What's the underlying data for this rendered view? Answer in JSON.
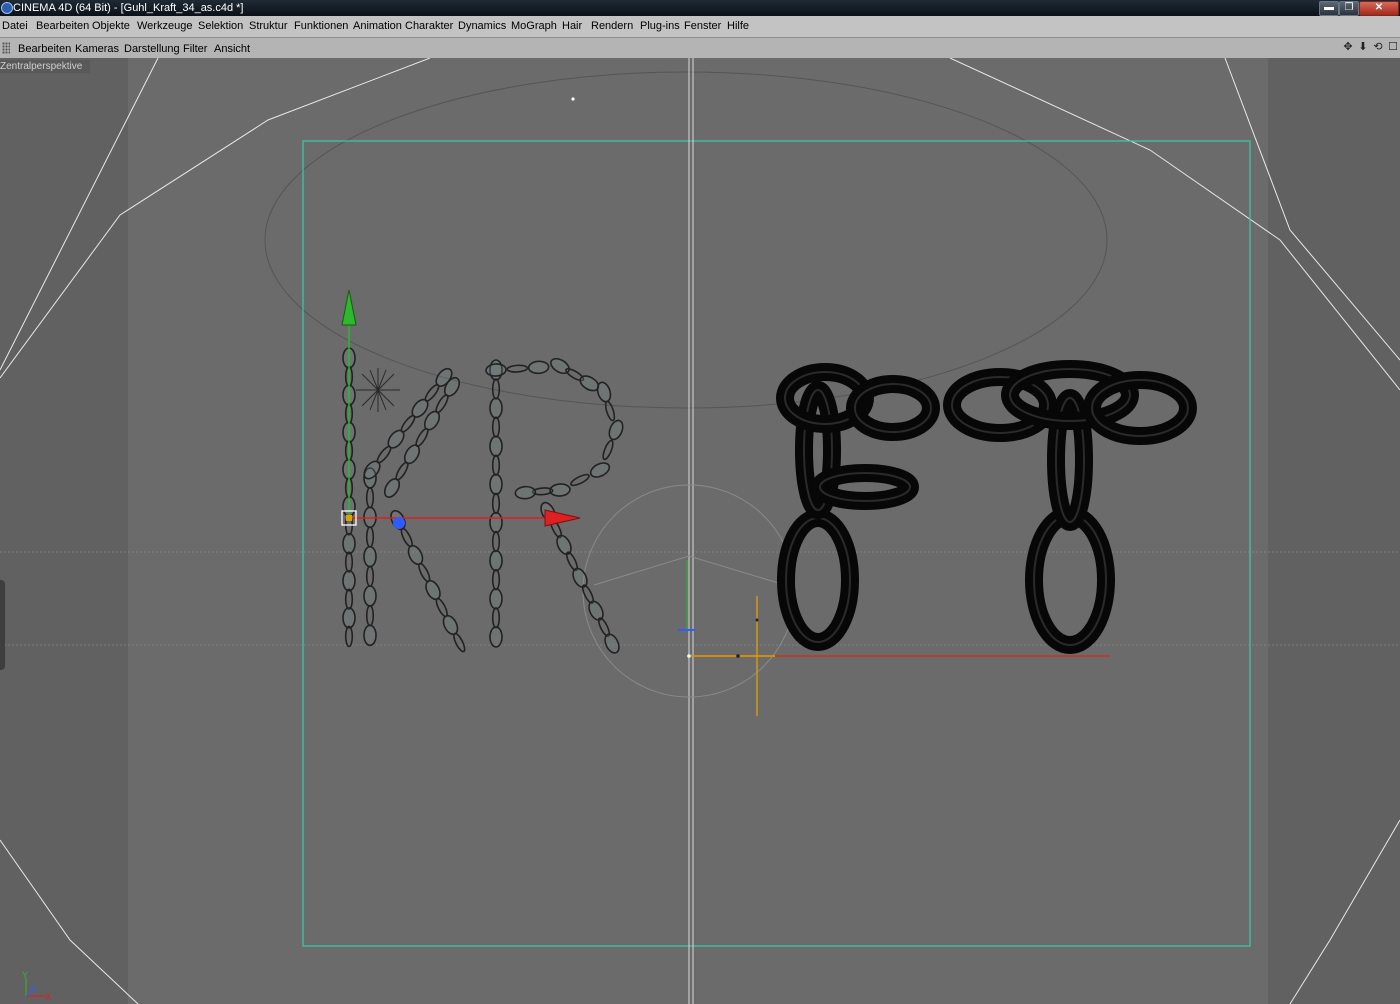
{
  "window": {
    "title": "CINEMA 4D (64 Bit) - [Guhl_Kraft_34_as.c4d *]",
    "minimize_glyph": "▬",
    "maximize_glyph": "❐",
    "close_glyph": "✕"
  },
  "menu": {
    "items": [
      "Datei",
      "Bearbeiten",
      "Objekte",
      "Werkzeuge",
      "Selektion",
      "Struktur",
      "Funktionen",
      "Animation",
      "Charakter",
      "Dynamics",
      "MoGraph",
      "Hair",
      "Rendern",
      "Plug-ins",
      "Fenster",
      "Hilfe"
    ]
  },
  "viewport_menu": {
    "items": [
      "Bearbeiten",
      "Kameras",
      "Darstellung",
      "Filter",
      "Ansicht"
    ],
    "nav_icons": [
      {
        "name": "move-view-icon",
        "glyph": "✥"
      },
      {
        "name": "zoom-view-icon",
        "glyph": "⬇"
      },
      {
        "name": "rotate-view-icon",
        "glyph": "⟲"
      },
      {
        "name": "maximize-view-icon",
        "glyph": "☐"
      }
    ]
  },
  "viewport": {
    "camera_label": "Zentralperspektive",
    "axis_labels": {
      "y": "Y",
      "z": "Z",
      "x": "X"
    },
    "colors": {
      "background": "#6b6b6b",
      "safe_frame": "#3fc2a8",
      "axis_y": "#2eb82e",
      "axis_x": "#dd2020",
      "axis_z": "#2f5cff",
      "spline_selected": "#e0a000",
      "chain_solid": "#070707"
    }
  }
}
